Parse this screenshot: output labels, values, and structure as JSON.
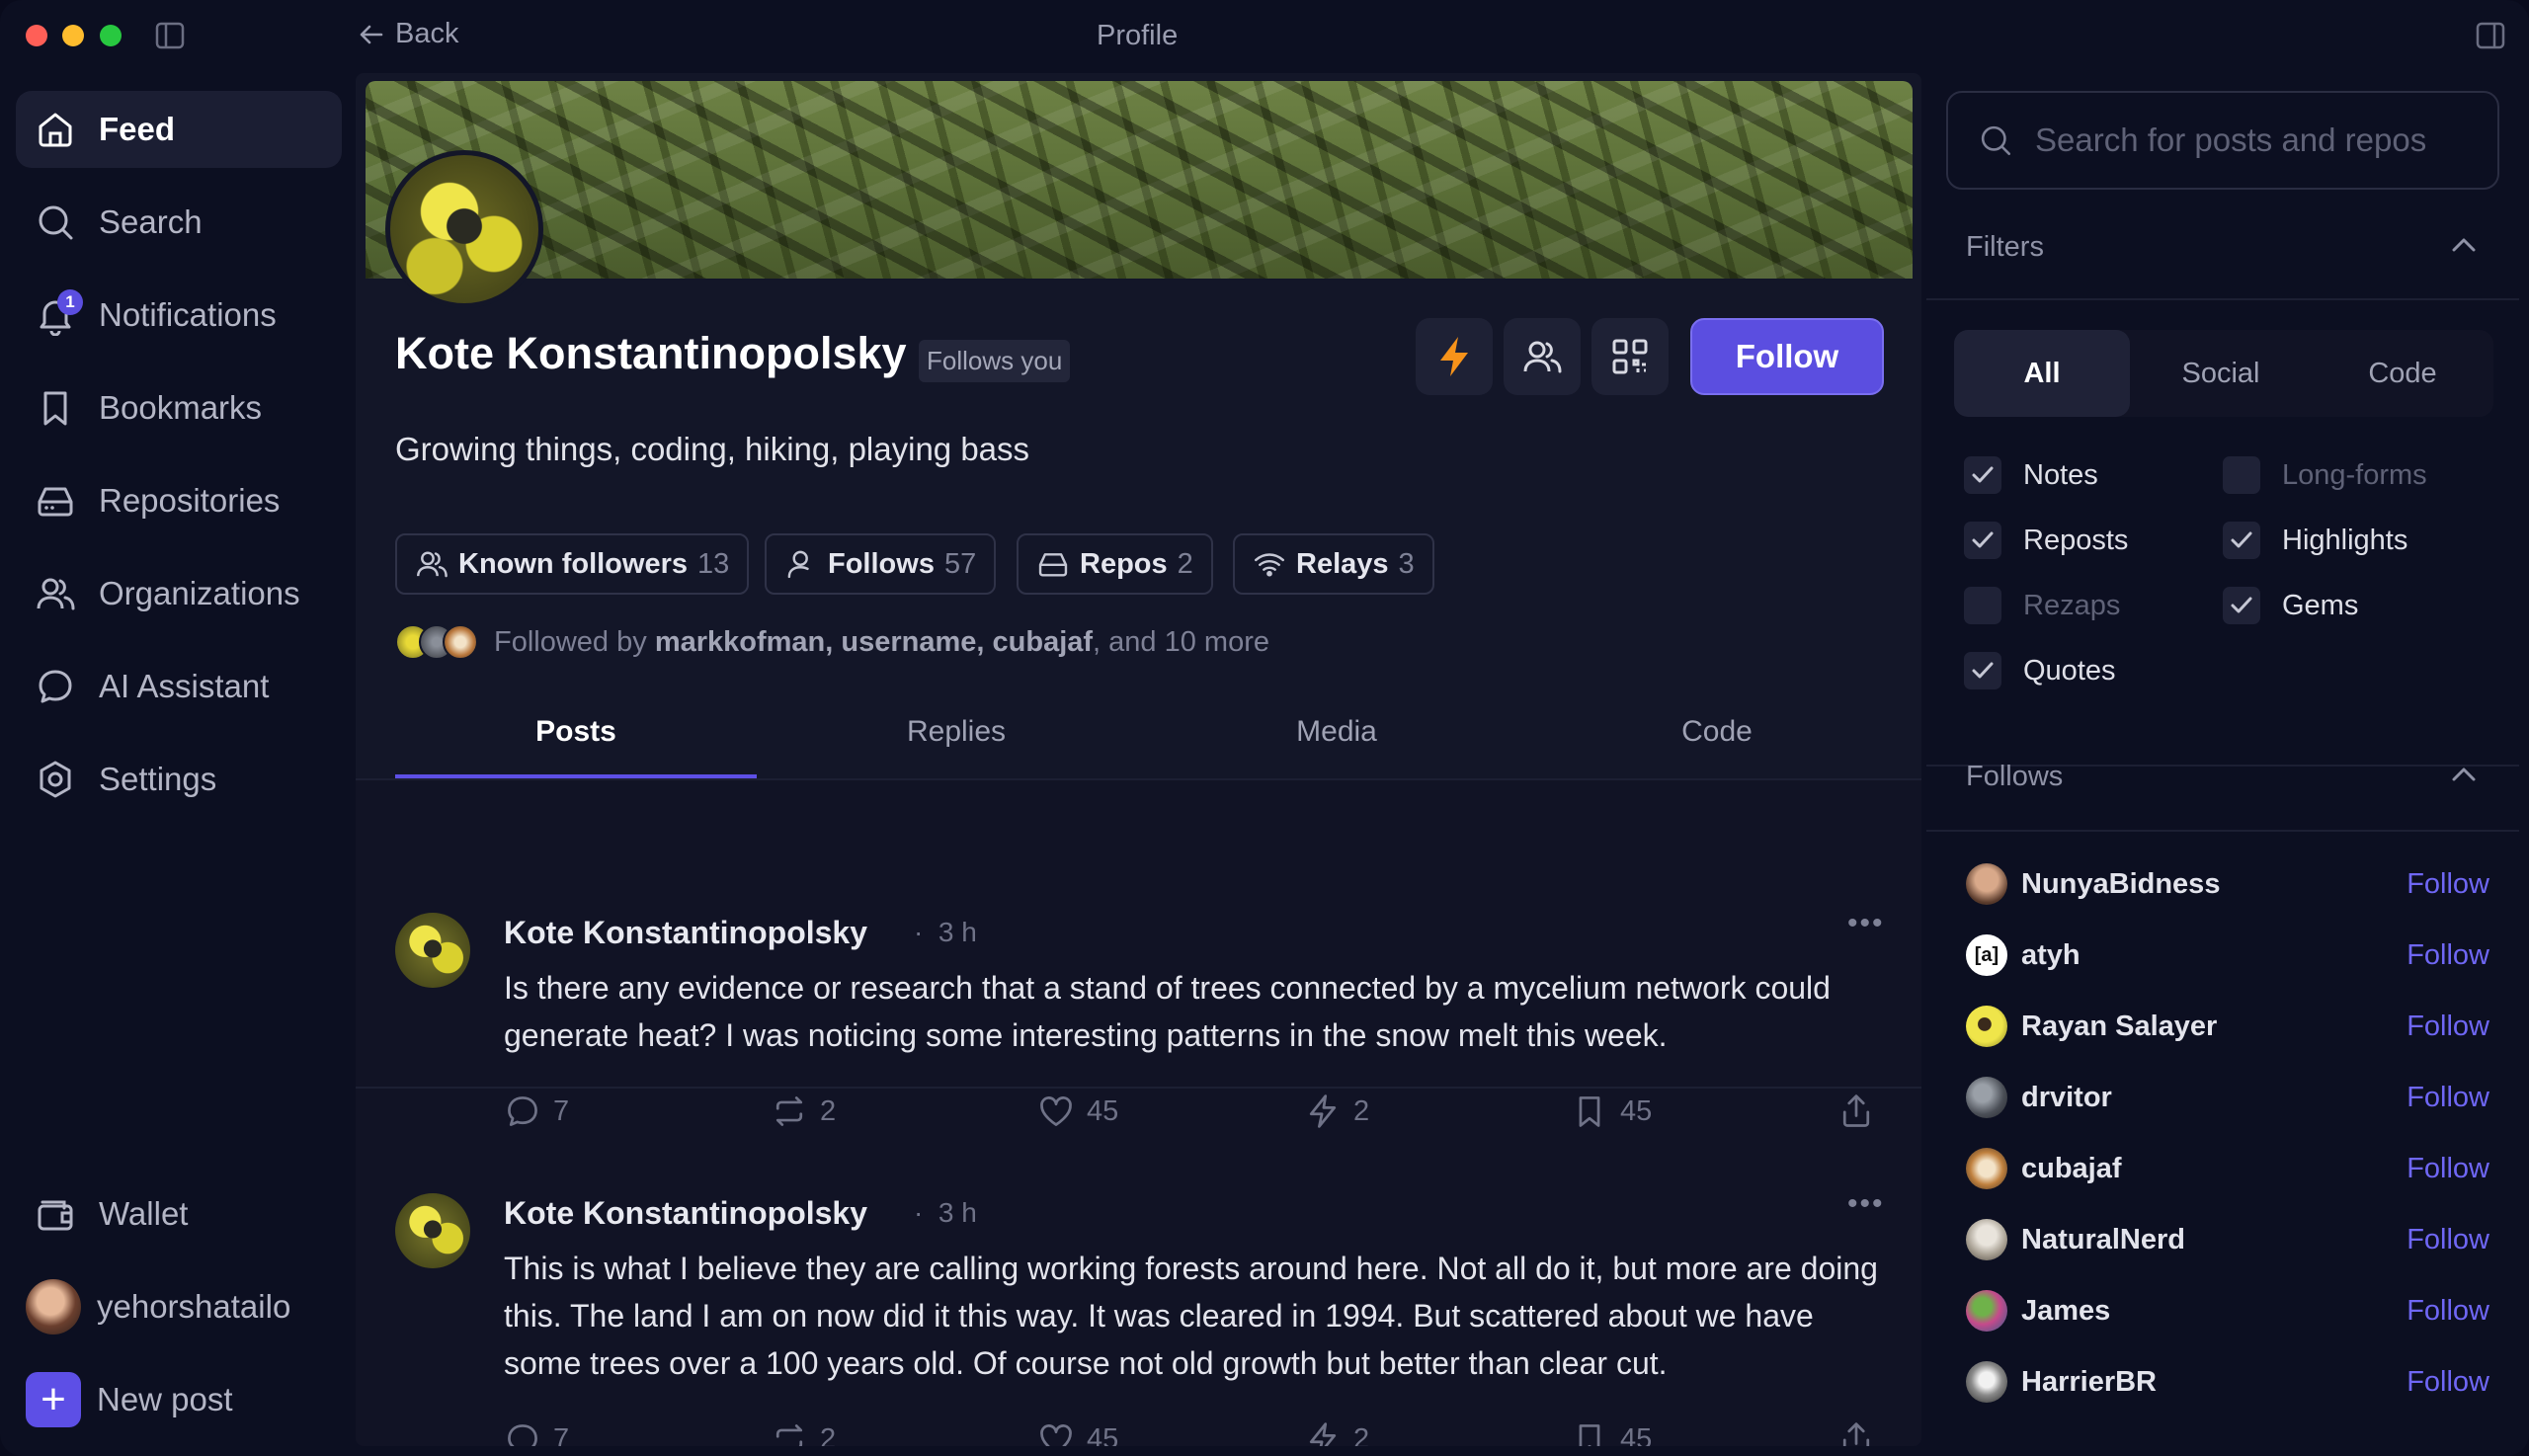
{
  "window": {
    "back_label": "Back",
    "title": "Profile"
  },
  "sidebar": {
    "items": [
      {
        "label": "Feed",
        "icon": "home-icon"
      },
      {
        "label": "Search",
        "icon": "search-icon"
      },
      {
        "label": "Notifications",
        "icon": "bell-icon",
        "badge": "1"
      },
      {
        "label": "Bookmarks",
        "icon": "bookmark-icon"
      },
      {
        "label": "Repositories",
        "icon": "repository-icon"
      },
      {
        "label": "Organizations",
        "icon": "users-icon"
      },
      {
        "label": "AI Assistant",
        "icon": "chat-icon"
      },
      {
        "label": "Settings",
        "icon": "gear-icon"
      }
    ],
    "wallet_label": "Wallet",
    "user_label": "yehorshatailo",
    "new_post_label": "New post"
  },
  "profile": {
    "name": "Kote Konstantinopolsky",
    "follows_you": "Follows you",
    "follow_label": "Follow",
    "bio": "Growing things, coding, hiking, playing bass",
    "stats": [
      {
        "label": "Known followers",
        "count": "13"
      },
      {
        "label": "Follows",
        "count": "57"
      },
      {
        "label": "Repos",
        "count": "2"
      },
      {
        "label": "Relays",
        "count": "3"
      }
    ],
    "followed_by_prefix": "Followed by",
    "followed_by_names": "markkofman, username, cubajaf",
    "followed_by_suffix": ", and 10 more",
    "tabs": [
      "Posts",
      "Replies",
      "Media",
      "Code"
    ]
  },
  "posts": [
    {
      "author": "Kote Konstantinopolsky",
      "time": "3 h",
      "text": "Is there any evidence or research that a stand of trees connected by a mycelium network could generate heat? I was noticing some interesting patterns in the snow melt this week.",
      "replies": "7",
      "reposts": "2",
      "likes": "45",
      "zaps": "2",
      "bookmarks": "45"
    },
    {
      "author": "Kote Konstantinopolsky",
      "time": "3 h",
      "text": "This is what I believe they are calling working forests around here. Not all do it, but more are doing this. The land I am on now did it this way. It was cleared in 1994. But scattered about we have some trees over a 100 years old. Of course not old growth but better than clear cut.",
      "replies": "7",
      "reposts": "2",
      "likes": "45",
      "zaps": "2",
      "bookmarks": "45"
    }
  ],
  "right_panel": {
    "search_placeholder": "Search for posts and repos",
    "filters_label": "Filters",
    "segments": [
      "All",
      "Social",
      "Code"
    ],
    "checks": {
      "notes": "Notes",
      "long_forms": "Long-forms",
      "reposts": "Reposts",
      "highlights": "Highlights",
      "rezaps": "Rezaps",
      "gems": "Gems",
      "quotes": "Quotes"
    },
    "follows_label": "Follows",
    "follows": [
      {
        "name": "NunyaBidness",
        "action": "Follow"
      },
      {
        "name": "atyh",
        "action": "Follow"
      },
      {
        "name": "Rayan Salayer",
        "action": "Follow"
      },
      {
        "name": "drvitor",
        "action": "Follow"
      },
      {
        "name": "cubajaf",
        "action": "Follow"
      },
      {
        "name": "NaturalNerd",
        "action": "Follow"
      },
      {
        "name": "James",
        "action": "Follow"
      },
      {
        "name": "HarrierBR",
        "action": "Follow"
      }
    ]
  },
  "colors": {
    "accent": "#5b4ee0",
    "zap": "#f7931a",
    "link": "#6f67f5"
  }
}
